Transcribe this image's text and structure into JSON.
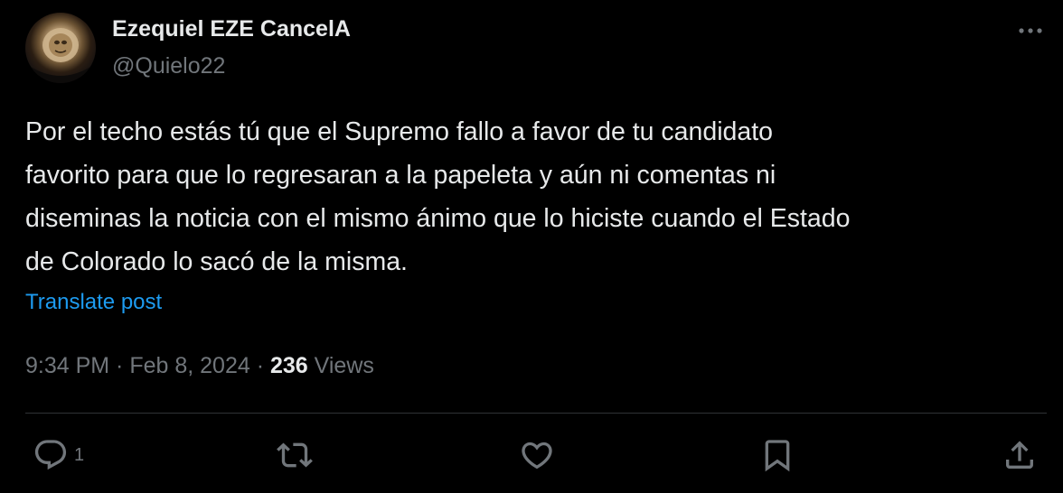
{
  "author": {
    "display_name": "Ezequiel EZE CancelA",
    "handle": "@Quielo22"
  },
  "post": {
    "text": "Por el techo estás tú que el Supremo fallo a favor de tu candidato\nfavorito para que lo regresaran a la papeleta y aún ni comentas ni\ndiseminas la noticia con el mismo ánimo que lo hiciste cuando el Estado\nde Colorado lo sacó de la misma.",
    "translate_label": "Translate post",
    "time": "9:34 PM",
    "separator_1": " · ",
    "date": "Feb 8, 2024",
    "separator_2": " · ",
    "views_count": "236",
    "views_label": " Views"
  },
  "actions": {
    "reply_count": "1"
  },
  "colors": {
    "background": "#000000",
    "text_primary": "#e7e9ea",
    "text_secondary": "#71767b",
    "link": "#1d9bf0",
    "divider": "#2f3336"
  },
  "icons": {
    "avatar": "profile-photo",
    "more": "more-horizontal-icon",
    "reply": "reply-icon",
    "repost": "repost-icon",
    "like": "like-icon",
    "bookmark": "bookmark-icon",
    "share": "share-icon"
  }
}
